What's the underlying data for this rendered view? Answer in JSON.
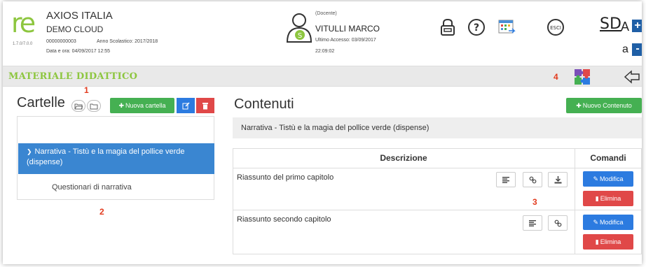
{
  "header": {
    "logo_text": "re",
    "version": "1.7.0/7.0.0",
    "school_name": "AXIOS ITALIA",
    "school_sub": "DEMO CLOUD",
    "school_code": "00000000003",
    "school_year": "Anno Scolastico: 2017/2018",
    "date": "Data e ora: 04/09/2017 12:55",
    "user_role": "(Docente)",
    "user_name": "VITULLI MARCO",
    "user_badge": "S",
    "last_access": "Ultimo Accesso: 03/09/2017",
    "last_time": "22:09:02",
    "exit_label": "ESCI",
    "sd_label": "SD",
    "font_big": "A",
    "font_small": "a",
    "plus": "+",
    "minus": "-"
  },
  "titlebar": {
    "title": "MATERIALE DIDATTICO",
    "marker4": "4"
  },
  "left": {
    "marker1": "1",
    "title": "Cartelle",
    "new_folder": "Nuova cartella",
    "selected_folder": "Narrativa - Tistù e la magia del pollice verde (dispense)",
    "child_folder": "Questionari di narrativa",
    "marker2": "2"
  },
  "right": {
    "title": "Contenuti",
    "new_content": "Nuovo Contenuto",
    "path": "Narrativa - Tistù e la magia del pollice verde (dispense)",
    "col_desc": "Descrizione",
    "col_cmd": "Comandi",
    "rows": [
      {
        "desc": "Riassunto del primo capitolo",
        "modify": "Modifica",
        "delete": "Elimina"
      },
      {
        "desc": "Riassunto secondo capitolo",
        "modify": "Modifica",
        "delete": "Elimina"
      }
    ],
    "marker3": "3"
  },
  "colors": {
    "brand_green": "#8dc63f",
    "button_green": "#45b052",
    "button_blue": "#2c7be0",
    "button_red": "#e04848",
    "selected_blue": "#3a86d1",
    "marker_red": "#e23a1d"
  }
}
